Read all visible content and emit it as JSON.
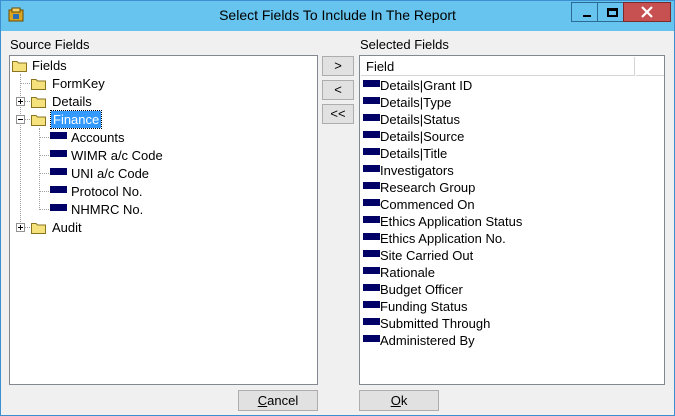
{
  "window": {
    "title": "Select Fields To Include In The Report",
    "colors": {
      "titlebar": "#67c4ee",
      "close": "#c75050",
      "selection": "#3399ff",
      "field_icon": "#000066"
    }
  },
  "source": {
    "label": "Source Fields",
    "tree": {
      "root": "Fields",
      "formkey": "FormKey",
      "details": "Details",
      "finance": "Finance",
      "finance_children": [
        "Accounts",
        "WIMR a/c Code",
        "UNI a/c Code",
        "Protocol No.",
        "NHMRC No."
      ],
      "audit": "Audit"
    }
  },
  "buttons": {
    "add": ">",
    "remove": "<",
    "remove_all": "<<",
    "cancel_first": "C",
    "cancel_rest": "ancel",
    "ok_first": "O",
    "ok_rest": "k"
  },
  "selected": {
    "label": "Selected Fields",
    "column_header": "Field",
    "items": [
      "Details|Grant ID",
      "Details|Type",
      "Details|Status",
      "Details|Source",
      "Details|Title",
      "Investigators",
      "Research Group",
      "Commenced On",
      "Ethics Application Status",
      "Ethics Application No.",
      "Site Carried Out",
      "Rationale",
      "Budget Officer",
      "Funding Status",
      "Submitted Through",
      "Administered By"
    ]
  }
}
